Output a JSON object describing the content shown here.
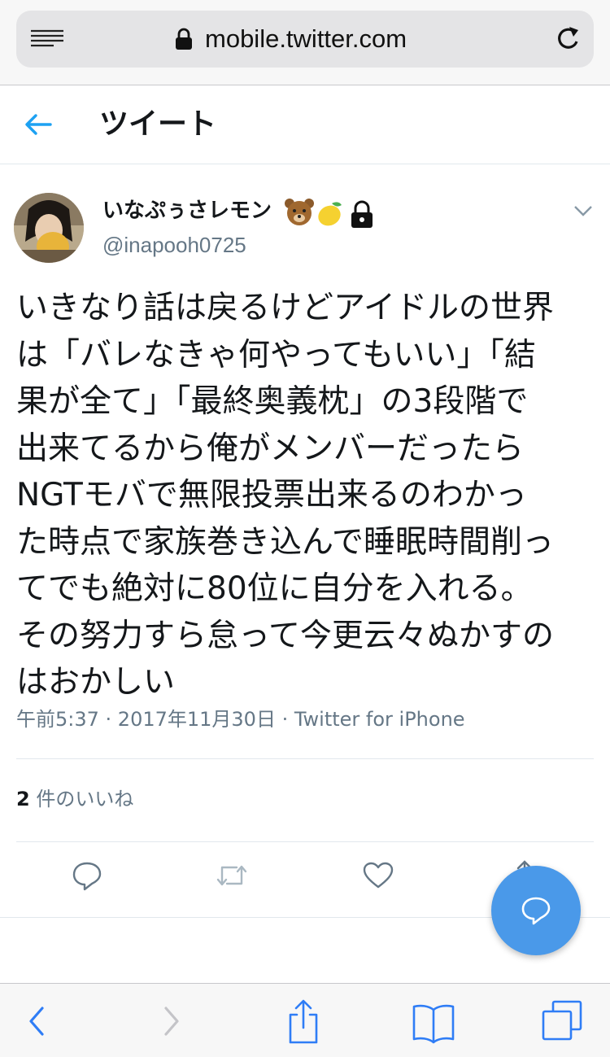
{
  "browser": {
    "url": "mobile.twitter.com"
  },
  "header": {
    "title": "ツイート"
  },
  "tweet": {
    "display_name": "いなぷぅさレモン",
    "handle": "@inapooh0725",
    "text_lines": [
      "いきなり話は戻るけどアイドルの世界",
      "は「バレなきゃ何やってもいい」「結",
      "果が全て」「最終奥義枕」の3段階で",
      "出来てるから俺がメンバーだったら",
      "NGTモバで無限投票出来るのわかっ",
      "た時点で家族巻き込んで睡眠時間削っ",
      "てでも絶対に80位に自分を入れる。",
      "その努力すら怠って今更云々ぬかすの",
      "はおかしい"
    ],
    "time": "午前5:37",
    "date": "2017年11月30日",
    "source": "Twitter for iPhone",
    "separator": " · ",
    "likes_count": "2",
    "likes_label": " 件のいいね"
  },
  "icons": {
    "badges": [
      "bear-face-icon",
      "lemon-icon",
      "lock-icon"
    ],
    "actions": [
      "reply-icon",
      "retweet-icon",
      "like-icon",
      "share-icon"
    ],
    "fab": "compose-icon",
    "toolbar": [
      "back-icon",
      "forward-icon",
      "share-icon",
      "bookmarks-icon",
      "tabs-icon"
    ]
  },
  "colors": {
    "accent": "#1da1f2",
    "fab": "#4a99e9",
    "secondary_text": "#657786"
  }
}
